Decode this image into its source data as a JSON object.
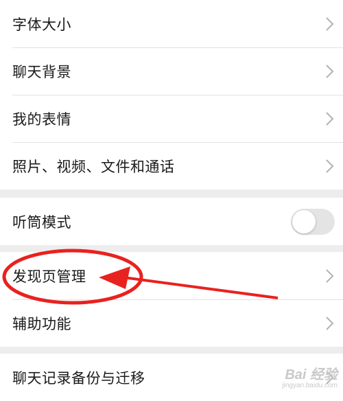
{
  "groups": [
    {
      "items": [
        {
          "label": "字体大小"
        },
        {
          "label": "聊天背景"
        },
        {
          "label": "我的表情"
        },
        {
          "label": "照片、视频、文件和通话"
        }
      ]
    },
    {
      "items": [
        {
          "label": "听筒模式",
          "toggle_on": false
        }
      ]
    },
    {
      "items": [
        {
          "label": "发现页管理"
        },
        {
          "label": "辅助功能"
        }
      ]
    },
    {
      "items": [
        {
          "label": "聊天记录备份与迁移"
        }
      ]
    }
  ],
  "colors": {
    "background": "#ededed",
    "row": "#ffffff",
    "chevron": "#b2b2b2",
    "annotation": "#e8221f",
    "toggle_off": "#e4e4e4"
  },
  "watermark": {
    "line1": "Bai 经验",
    "line2": "jingyan.baidu.com"
  }
}
